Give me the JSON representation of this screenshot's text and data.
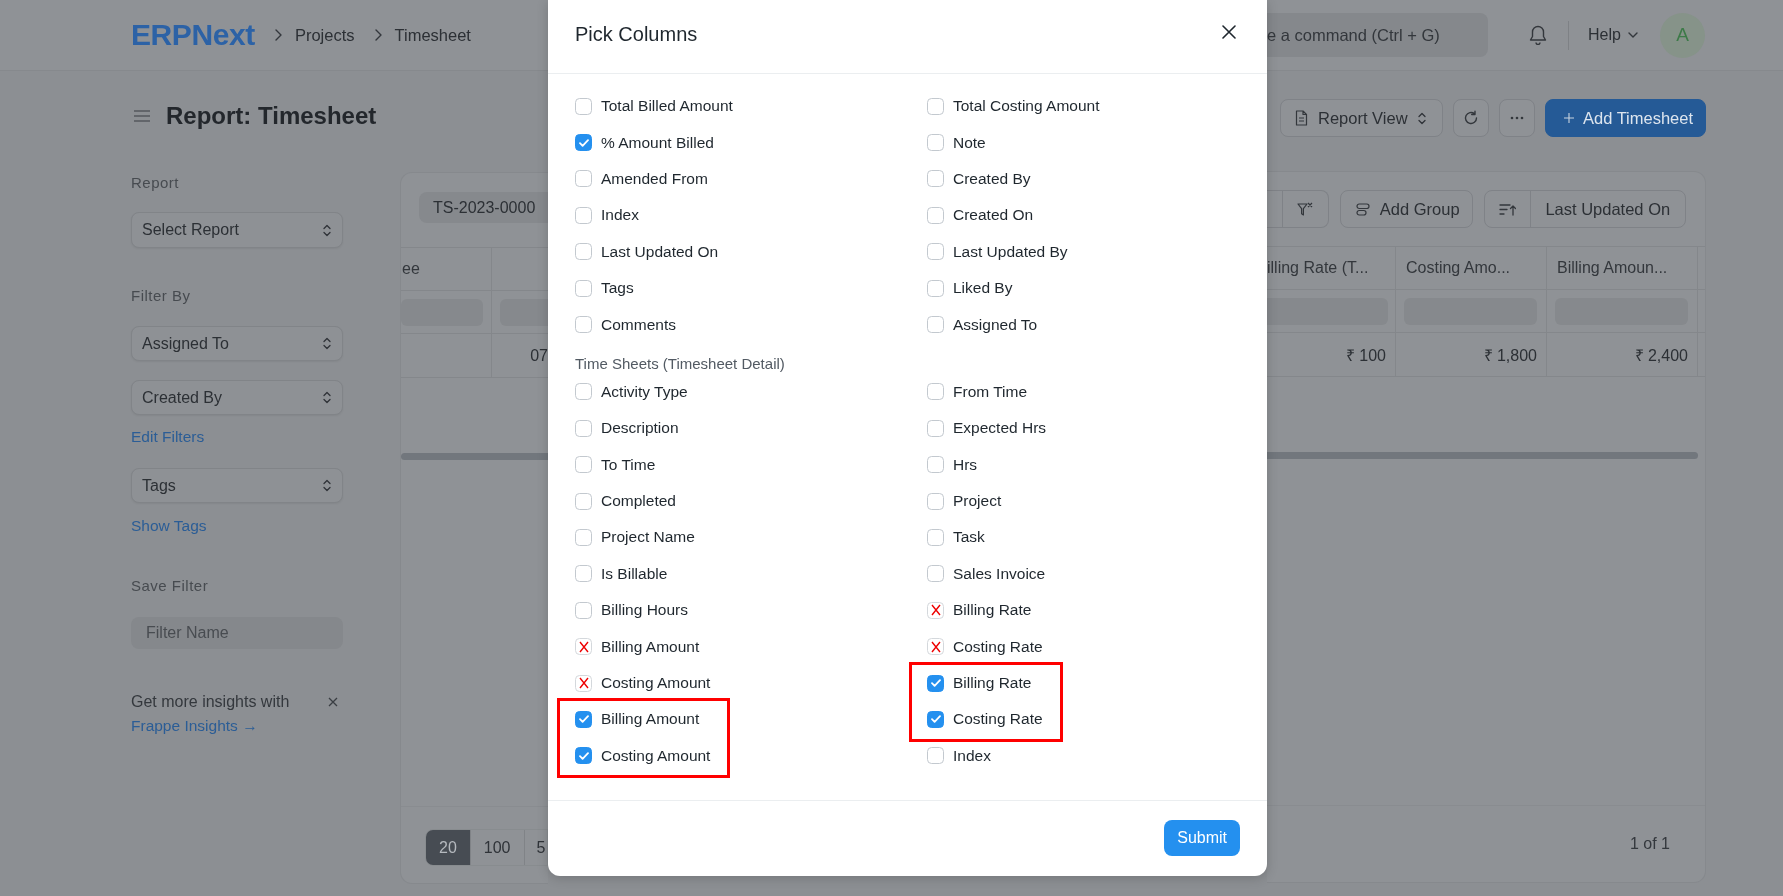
{
  "navbar": {
    "logo": "ERPNext",
    "breadcrumbs": [
      "Projects",
      "Timesheet"
    ],
    "search": {
      "placeholder": "e a command (Ctrl + G)"
    },
    "help": "Help",
    "avatar": "A"
  },
  "page": {
    "title": "Report: Timesheet",
    "view_switcher": "Report View",
    "primary_action": "Add Timesheet"
  },
  "sidebar": {
    "report_label": "Report",
    "report_select": "Select Report",
    "filter_label": "Filter By",
    "filter_selects": [
      "Assigned To",
      "Created By"
    ],
    "edit_filters": "Edit Filters",
    "tags_select": "Tags",
    "show_tags": "Show Tags",
    "save_filter_label": "Save Filter",
    "filter_name": {
      "placeholder": "Filter Name"
    },
    "insights": {
      "text": "Get more insights with",
      "link": "Frappe Insights →"
    }
  },
  "report": {
    "filter_chip": "TS-2023-0000",
    "add_group": "Add Group",
    "sort_field": "Last Updated On",
    "left_columns": [
      {
        "header": "ee"
      },
      {
        "cell": "07"
      }
    ],
    "right_columns": [
      {
        "header": "illing Rate (T...",
        "cell": "₹ 100"
      },
      {
        "header": "Costing Amo...",
        "cell": "₹ 1,800"
      },
      {
        "header": "Billing Amoun...",
        "cell": "₹ 2,400"
      }
    ],
    "page_sizes": [
      {
        "label": "20",
        "selected": true
      },
      {
        "label": "100",
        "selected": false
      },
      {
        "label": "5",
        "selected": false
      }
    ],
    "page_count": "1 of 1"
  },
  "dialog": {
    "title": "Pick Columns",
    "submit": "Submit",
    "sections": [
      {
        "columns": [
          {
            "items": [
              {
                "label": "Total Billed Amount",
                "checked": false,
                "crossed": false,
                "outlined": false
              },
              {
                "label": "% Amount Billed",
                "checked": true,
                "crossed": false,
                "outlined": false
              },
              {
                "label": "Amended From",
                "checked": false,
                "crossed": false,
                "outlined": false
              },
              {
                "label": "Index",
                "checked": false,
                "crossed": false,
                "outlined": false
              },
              {
                "label": "Last Updated On",
                "checked": false,
                "crossed": false,
                "outlined": false
              },
              {
                "label": "Tags",
                "checked": false,
                "crossed": false,
                "outlined": false
              },
              {
                "label": "Comments",
                "checked": false,
                "crossed": false,
                "outlined": false
              }
            ]
          },
          {
            "items": [
              {
                "label": "Total Costing Amount",
                "checked": false,
                "crossed": false,
                "outlined": false
              },
              {
                "label": "Note",
                "checked": false,
                "crossed": false,
                "outlined": false
              },
              {
                "label": "Created By",
                "checked": false,
                "crossed": false,
                "outlined": false
              },
              {
                "label": "Created On",
                "checked": false,
                "crossed": false,
                "outlined": false
              },
              {
                "label": "Last Updated By",
                "checked": false,
                "crossed": false,
                "outlined": false
              },
              {
                "label": "Liked By",
                "checked": false,
                "crossed": false,
                "outlined": false
              },
              {
                "label": "Assigned To",
                "checked": false,
                "crossed": false,
                "outlined": false
              }
            ]
          }
        ]
      },
      {
        "title": "Time Sheets (Timesheet Detail)",
        "columns": [
          {
            "items": [
              {
                "label": "Activity Type",
                "checked": false,
                "crossed": false,
                "outlined": false
              },
              {
                "label": "Description",
                "checked": false,
                "crossed": false,
                "outlined": false
              },
              {
                "label": "To Time",
                "checked": false,
                "crossed": false,
                "outlined": false
              },
              {
                "label": "Completed",
                "checked": false,
                "crossed": false,
                "outlined": false
              },
              {
                "label": "Project Name",
                "checked": false,
                "crossed": false,
                "outlined": false
              },
              {
                "label": "Is Billable",
                "checked": false,
                "crossed": false,
                "outlined": false
              },
              {
                "label": "Billing Hours",
                "checked": false,
                "crossed": false,
                "outlined": false
              },
              {
                "label": "Billing Amount",
                "checked": false,
                "crossed": true,
                "outlined": false
              },
              {
                "label": "Costing Amount",
                "checked": false,
                "crossed": true,
                "outlined": false
              },
              {
                "label": "Billing Amount",
                "checked": true,
                "crossed": false,
                "outlined": true
              },
              {
                "label": "Costing Amount",
                "checked": true,
                "crossed": false,
                "outlined": true
              }
            ]
          },
          {
            "items": [
              {
                "label": "From Time",
                "checked": false,
                "crossed": false,
                "outlined": false
              },
              {
                "label": "Expected Hrs",
                "checked": false,
                "crossed": false,
                "outlined": false
              },
              {
                "label": "Hrs",
                "checked": false,
                "crossed": false,
                "outlined": false
              },
              {
                "label": "Project",
                "checked": false,
                "crossed": false,
                "outlined": false
              },
              {
                "label": "Task",
                "checked": false,
                "crossed": false,
                "outlined": false
              },
              {
                "label": "Sales Invoice",
                "checked": false,
                "crossed": false,
                "outlined": false
              },
              {
                "label": "Billing Rate",
                "checked": false,
                "crossed": true,
                "outlined": false
              },
              {
                "label": "Costing Rate",
                "checked": false,
                "crossed": true,
                "outlined": false
              },
              {
                "label": "Billing Rate",
                "checked": true,
                "crossed": false,
                "outlined": true
              },
              {
                "label": "Costing Rate",
                "checked": true,
                "crossed": false,
                "outlined": true
              },
              {
                "label": "Index",
                "checked": false,
                "crossed": false,
                "outlined": false
              }
            ]
          }
        ]
      }
    ]
  }
}
